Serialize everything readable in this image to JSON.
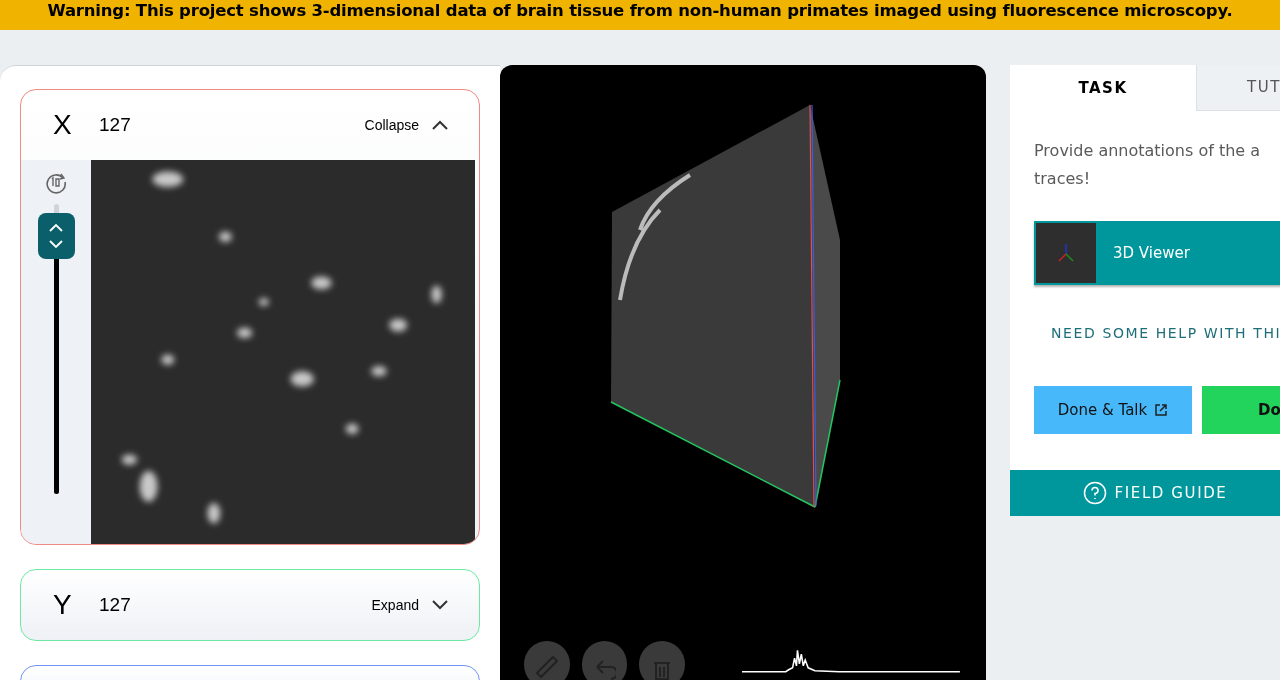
{
  "banner": {
    "text": "Warning: This project shows 3-dimensional data of brain tissue from non-human primates imaged using fluorescence microscopy."
  },
  "slices": [
    {
      "axis": "X",
      "value": "127",
      "toggle": "Collapse",
      "expanded": true,
      "color": "#f08a84",
      "slider": {
        "level": 0.97
      }
    },
    {
      "axis": "Y",
      "value": "127",
      "toggle": "Expand",
      "expanded": false,
      "color": "#6ee9a4"
    },
    {
      "expanded": false,
      "color": "#7394f5"
    }
  ],
  "viewer": {
    "tools": [
      {
        "kind": "pencil"
      },
      {
        "kind": "undo"
      },
      {
        "kind": "trash"
      }
    ]
  },
  "tabs": [
    {
      "label": "TASK",
      "selected": true
    },
    {
      "label": "TUT",
      "selected": false
    }
  ],
  "task": {
    "instruction_lines": [
      "Provide annotations of the a",
      "traces!"
    ],
    "tool_option": {
      "label": "3D Viewer",
      "selected": true
    },
    "help_link": "NEED SOME HELP WITH THI",
    "buttons": [
      {
        "label": "Done & Talk",
        "kind": "talk"
      },
      {
        "label": "Do",
        "kind": "done"
      }
    ]
  },
  "field_guide": {
    "label": "FIELD GUIDE"
  }
}
